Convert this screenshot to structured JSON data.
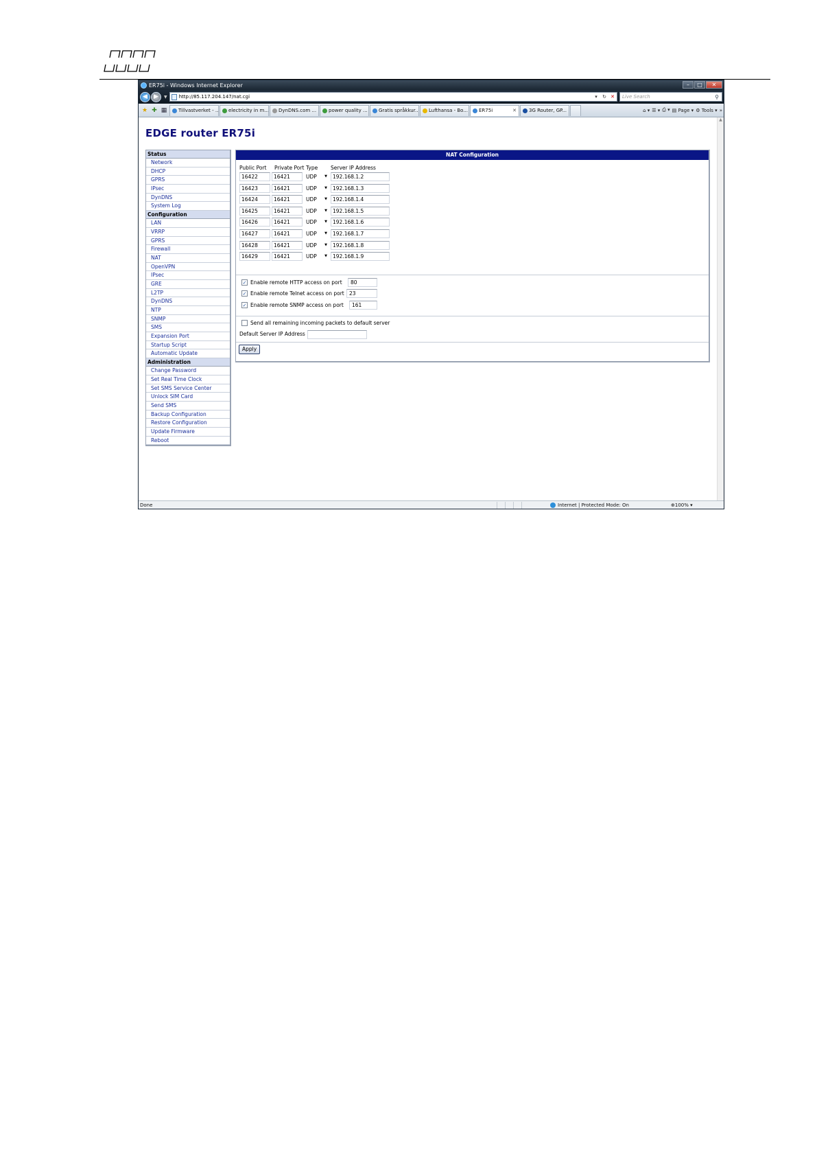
{
  "browser": {
    "window_title": "ER75i - Windows Internet Explorer",
    "url": "http://85.117.204.147/nat.cgi",
    "search_placeholder": "Live Search",
    "tabs": [
      {
        "label": "Tillvastverket - ..."
      },
      {
        "label": "electricity in m..."
      },
      {
        "label": "DynDNS.com ..."
      },
      {
        "label": "power quality ..."
      },
      {
        "label": "Gratis språkkur..."
      },
      {
        "label": "Lufthansa - Bo..."
      },
      {
        "label": "ER75i",
        "active": true
      },
      {
        "label": "3G Router, GP..."
      }
    ],
    "tools": {
      "page_label": "Page",
      "tools_label": "Tools"
    },
    "status": {
      "left": "Done",
      "zone": "Internet | Protected Mode: On",
      "zoom": "100%"
    }
  },
  "page": {
    "title": "EDGE router ER75i",
    "menu": [
      {
        "header": "Status",
        "items": [
          "Network",
          "DHCP",
          "GPRS",
          "IPsec",
          "DynDNS",
          "System Log"
        ]
      },
      {
        "header": "Configuration",
        "items": [
          "LAN",
          "VRRP",
          "GPRS",
          "Firewall",
          "NAT",
          "OpenVPN",
          "IPsec",
          "GRE",
          "L2TP",
          "DynDNS",
          "NTP",
          "SNMP",
          "SMS",
          "Expansion Port",
          "Startup Script",
          "Automatic Update"
        ]
      },
      {
        "header": "Administration",
        "items": [
          "Change Password",
          "Set Real Time Clock",
          "Set SMS Service Center",
          "Unlock SIM Card",
          "Send SMS",
          "Backup Configuration",
          "Restore Configuration",
          "Update Firmware",
          "Reboot"
        ]
      }
    ],
    "nat": {
      "title": "NAT Configuration",
      "columns": {
        "public_port": "Public Port",
        "private_port": "Private Port",
        "type": "Type",
        "server_ip": "Server IP Address"
      },
      "rows": [
        {
          "public": "16422",
          "private": "16421",
          "type": "UDP",
          "ip": "192.168.1.2"
        },
        {
          "public": "16423",
          "private": "16421",
          "type": "UDP",
          "ip": "192.168.1.3"
        },
        {
          "public": "16424",
          "private": "16421",
          "type": "UDP",
          "ip": "192.168.1.4"
        },
        {
          "public": "16425",
          "private": "16421",
          "type": "UDP",
          "ip": "192.168.1.5"
        },
        {
          "public": "16426",
          "private": "16421",
          "type": "UDP",
          "ip": "192.168.1.6"
        },
        {
          "public": "16427",
          "private": "16421",
          "type": "UDP",
          "ip": "192.168.1.7"
        },
        {
          "public": "16428",
          "private": "16421",
          "type": "UDP",
          "ip": "192.168.1.8"
        },
        {
          "public": "16429",
          "private": "16421",
          "type": "UDP",
          "ip": "192.168.1.9"
        }
      ],
      "remote": [
        {
          "label": "Enable remote HTTP access on port",
          "checked": true,
          "port": "80"
        },
        {
          "label": "Enable remote Telnet access on port",
          "checked": true,
          "port": "23"
        },
        {
          "label": "Enable remote SNMP access on port",
          "checked": true,
          "port": "161"
        }
      ],
      "default_server": {
        "label": "Send all remaining incoming packets to default server",
        "checked": false
      },
      "default_ip_label": "Default Server IP Address",
      "default_ip_value": "",
      "apply_label": "Apply"
    }
  }
}
